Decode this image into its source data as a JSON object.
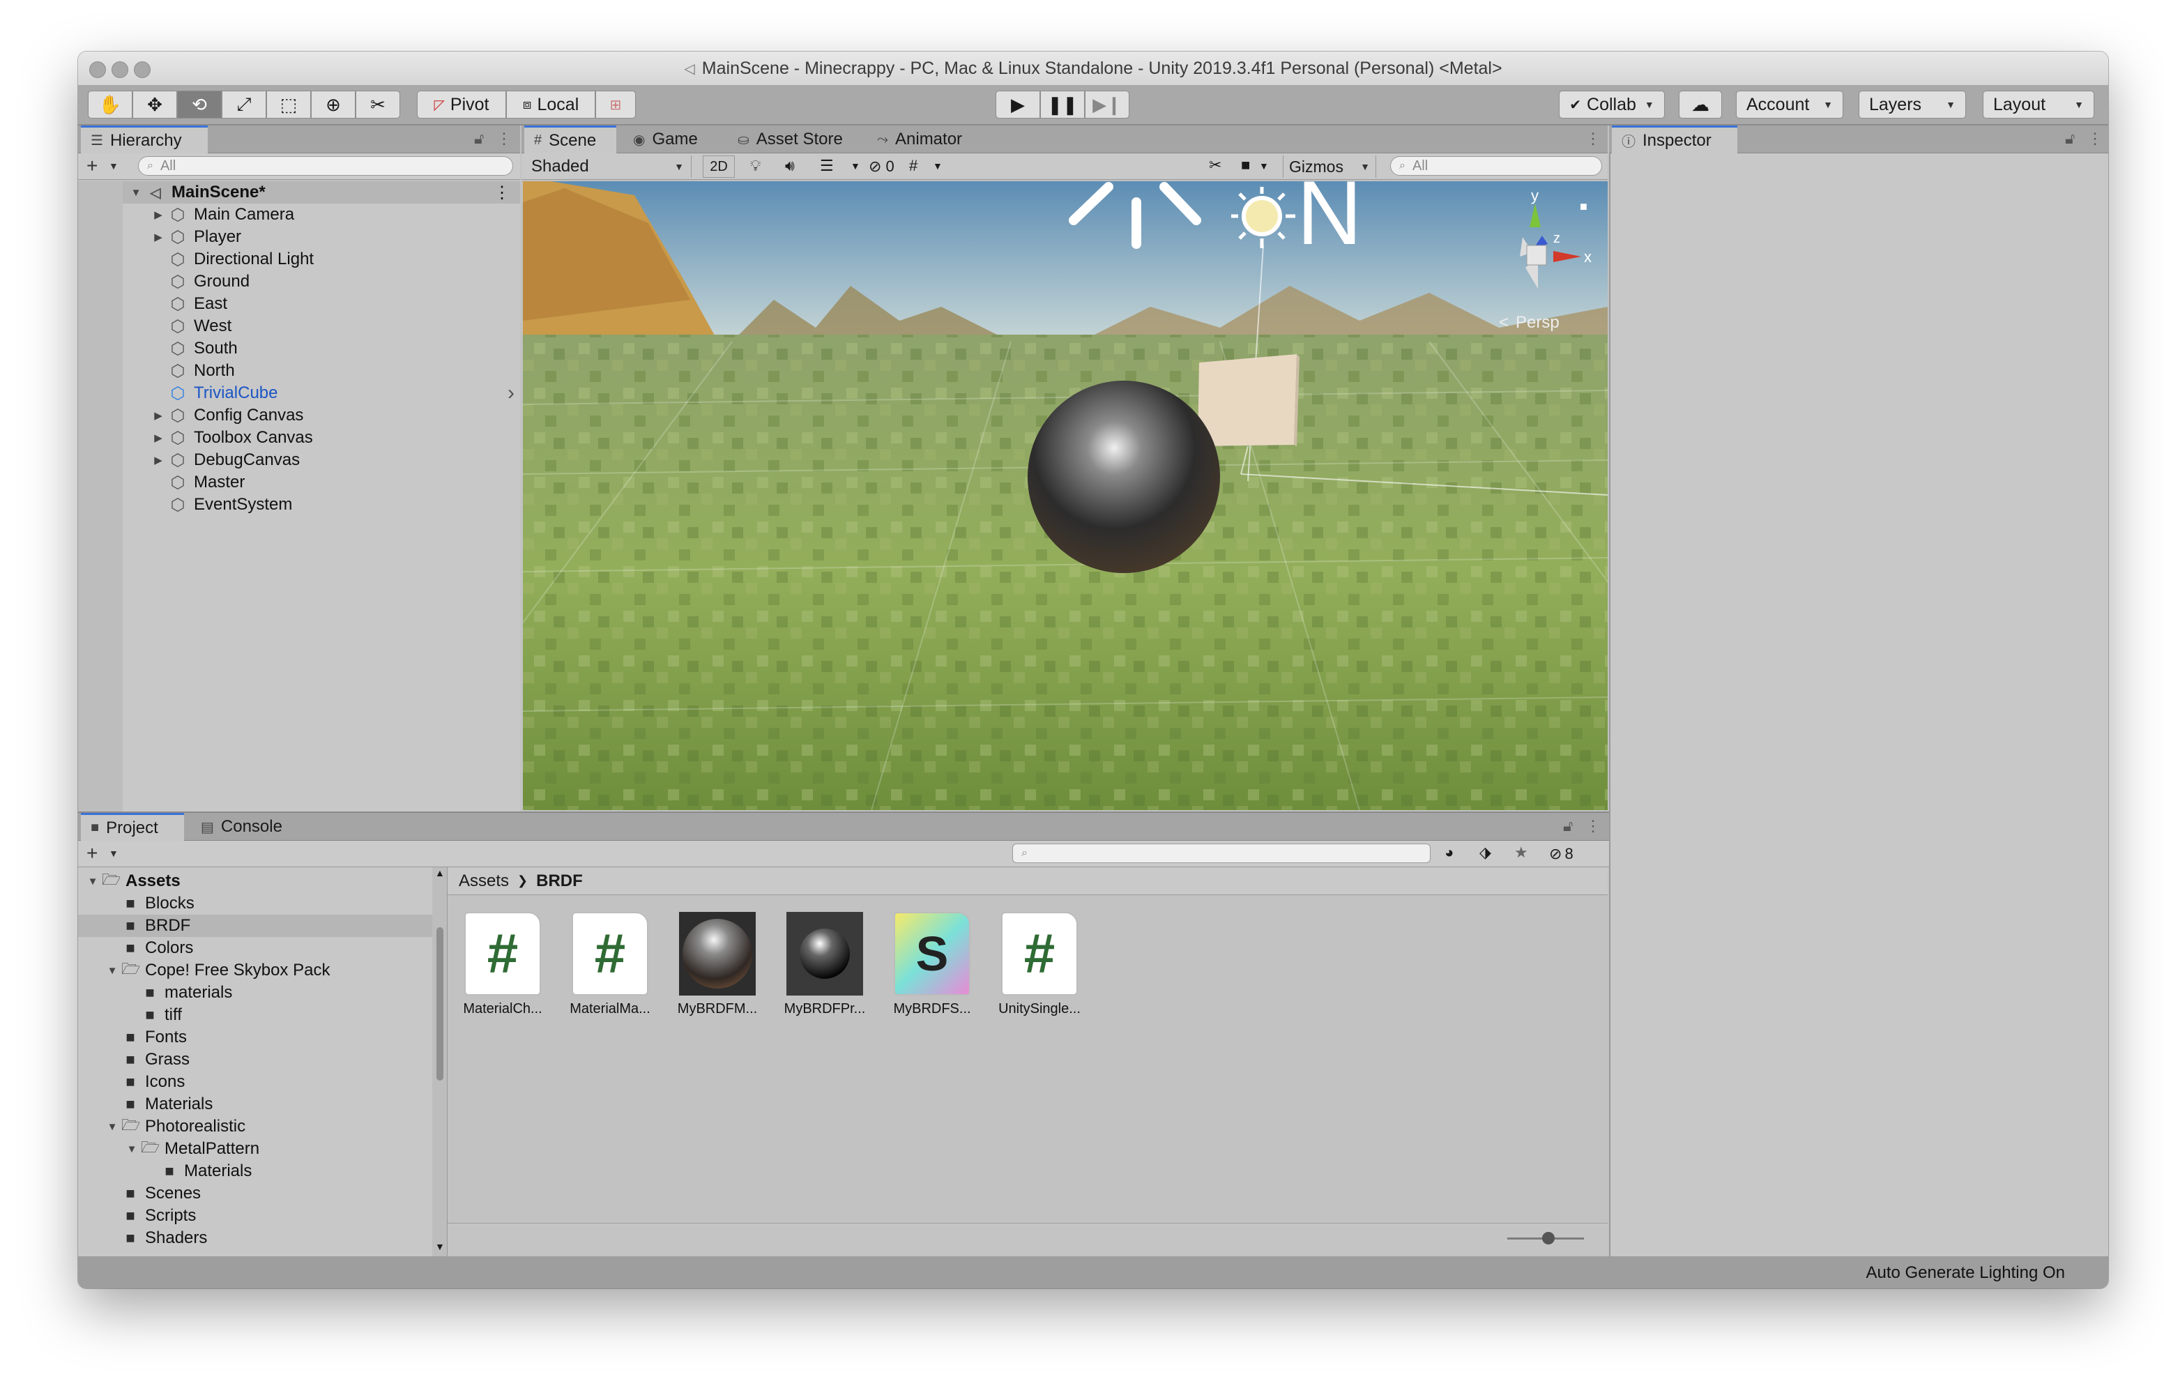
{
  "window": {
    "title": "MainScene - Minecrappy - PC, Mac & Linux Standalone - Unity 2019.3.4f1 Personal (Personal) <Metal>"
  },
  "toolbar": {
    "pivot_label": "Pivot",
    "local_label": "Local",
    "collab_label": "Collab",
    "account_label": "Account",
    "layers_label": "Layers",
    "layout_label": "Layout"
  },
  "hierarchy": {
    "tab_label": "Hierarchy",
    "search_placeholder": "All",
    "scene_name": "MainScene*",
    "items": [
      {
        "label": "Main Camera",
        "expandable": true
      },
      {
        "label": "Player",
        "expandable": true
      },
      {
        "label": "Directional Light",
        "expandable": false
      },
      {
        "label": "Ground",
        "expandable": false
      },
      {
        "label": "East",
        "expandable": false
      },
      {
        "label": "West",
        "expandable": false
      },
      {
        "label": "South",
        "expandable": false
      },
      {
        "label": "North",
        "expandable": false
      },
      {
        "label": "TrivialCube",
        "expandable": false,
        "selected": true
      },
      {
        "label": "Config Canvas",
        "expandable": true
      },
      {
        "label": "Toolbox Canvas",
        "expandable": true
      },
      {
        "label": "DebugCanvas",
        "expandable": true
      },
      {
        "label": "Master",
        "expandable": false
      },
      {
        "label": "EventSystem",
        "expandable": false
      }
    ]
  },
  "scene": {
    "tabs": [
      "Scene",
      "Game",
      "Asset Store",
      "Animator"
    ],
    "shading_mode": "Shaded",
    "mode_2d": "2D",
    "hidden_count": "0",
    "gizmos_label": "Gizmos",
    "search_placeholder": "All",
    "persp_label": "Persp",
    "axis_x": "x",
    "axis_y": "y",
    "axis_z": "z"
  },
  "inspector": {
    "tab_label": "Inspector"
  },
  "project": {
    "tabs": [
      "Project",
      "Console"
    ],
    "hidden_count": "8",
    "breadcrumb": [
      "Assets",
      "BRDF"
    ],
    "tree": [
      {
        "label": "Assets",
        "level": 0,
        "expanded": true,
        "bold": true
      },
      {
        "label": "Blocks",
        "level": 1
      },
      {
        "label": "BRDF",
        "level": 1,
        "selected": true
      },
      {
        "label": "Colors",
        "level": 1
      },
      {
        "label": "Cope! Free Skybox Pack",
        "level": 1,
        "expanded": true
      },
      {
        "label": "materials",
        "level": 2
      },
      {
        "label": "tiff",
        "level": 2
      },
      {
        "label": "Fonts",
        "level": 1
      },
      {
        "label": "Grass",
        "level": 1
      },
      {
        "label": "Icons",
        "level": 1
      },
      {
        "label": "Materials",
        "level": 1
      },
      {
        "label": "Photorealistic",
        "level": 1,
        "expanded": true
      },
      {
        "label": "MetalPattern",
        "level": 2,
        "expanded": true
      },
      {
        "label": "Materials",
        "level": 3
      },
      {
        "label": "Scenes",
        "level": 1
      },
      {
        "label": "Scripts",
        "level": 1
      },
      {
        "label": "Shaders",
        "level": 1
      }
    ],
    "assets": [
      {
        "label": "MaterialCh...",
        "kind": "script-icon"
      },
      {
        "label": "MaterialMa...",
        "kind": "script-icon"
      },
      {
        "label": "MyBRDFM...",
        "kind": "metal-material-icon"
      },
      {
        "label": "MyBRDFPr...",
        "kind": "sphere-material-icon"
      },
      {
        "label": "MyBRDFS...",
        "kind": "shader-icon"
      },
      {
        "label": "UnitySingle...",
        "kind": "script-icon"
      }
    ]
  },
  "status_bar": {
    "text": "Auto Generate Lighting On"
  },
  "colors": {
    "selection_blue": "#1b55c4",
    "tab_accent": "#3a72d8",
    "script_green": "#2f6b34"
  }
}
